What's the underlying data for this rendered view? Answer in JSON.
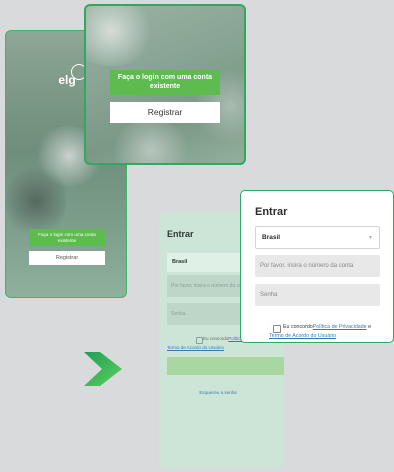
{
  "splash": {
    "logo_text": "elg",
    "login_label": "Faça o login com uma conta existente",
    "register_label": "Registrar"
  },
  "login": {
    "title": "Entrar",
    "country": "Brasil",
    "account_placeholder": "Por favor, insira o número da conta",
    "password_placeholder": "Senha",
    "consent_prefix": "Eu concordo",
    "privacy_link": "Política de Privacidade",
    "consent_conjunction": " e ",
    "terms_link": "Termo de Acordo do Usuário",
    "forgot_password": "Esqueceu a senha"
  },
  "colors": {
    "accent_green": "#5dbb50",
    "border_green": "#2fa865",
    "link_blue": "#3a79b8"
  },
  "icons": {
    "arrow": "chevron-right-arrow-icon",
    "dropdown": "chevron-down-icon"
  }
}
